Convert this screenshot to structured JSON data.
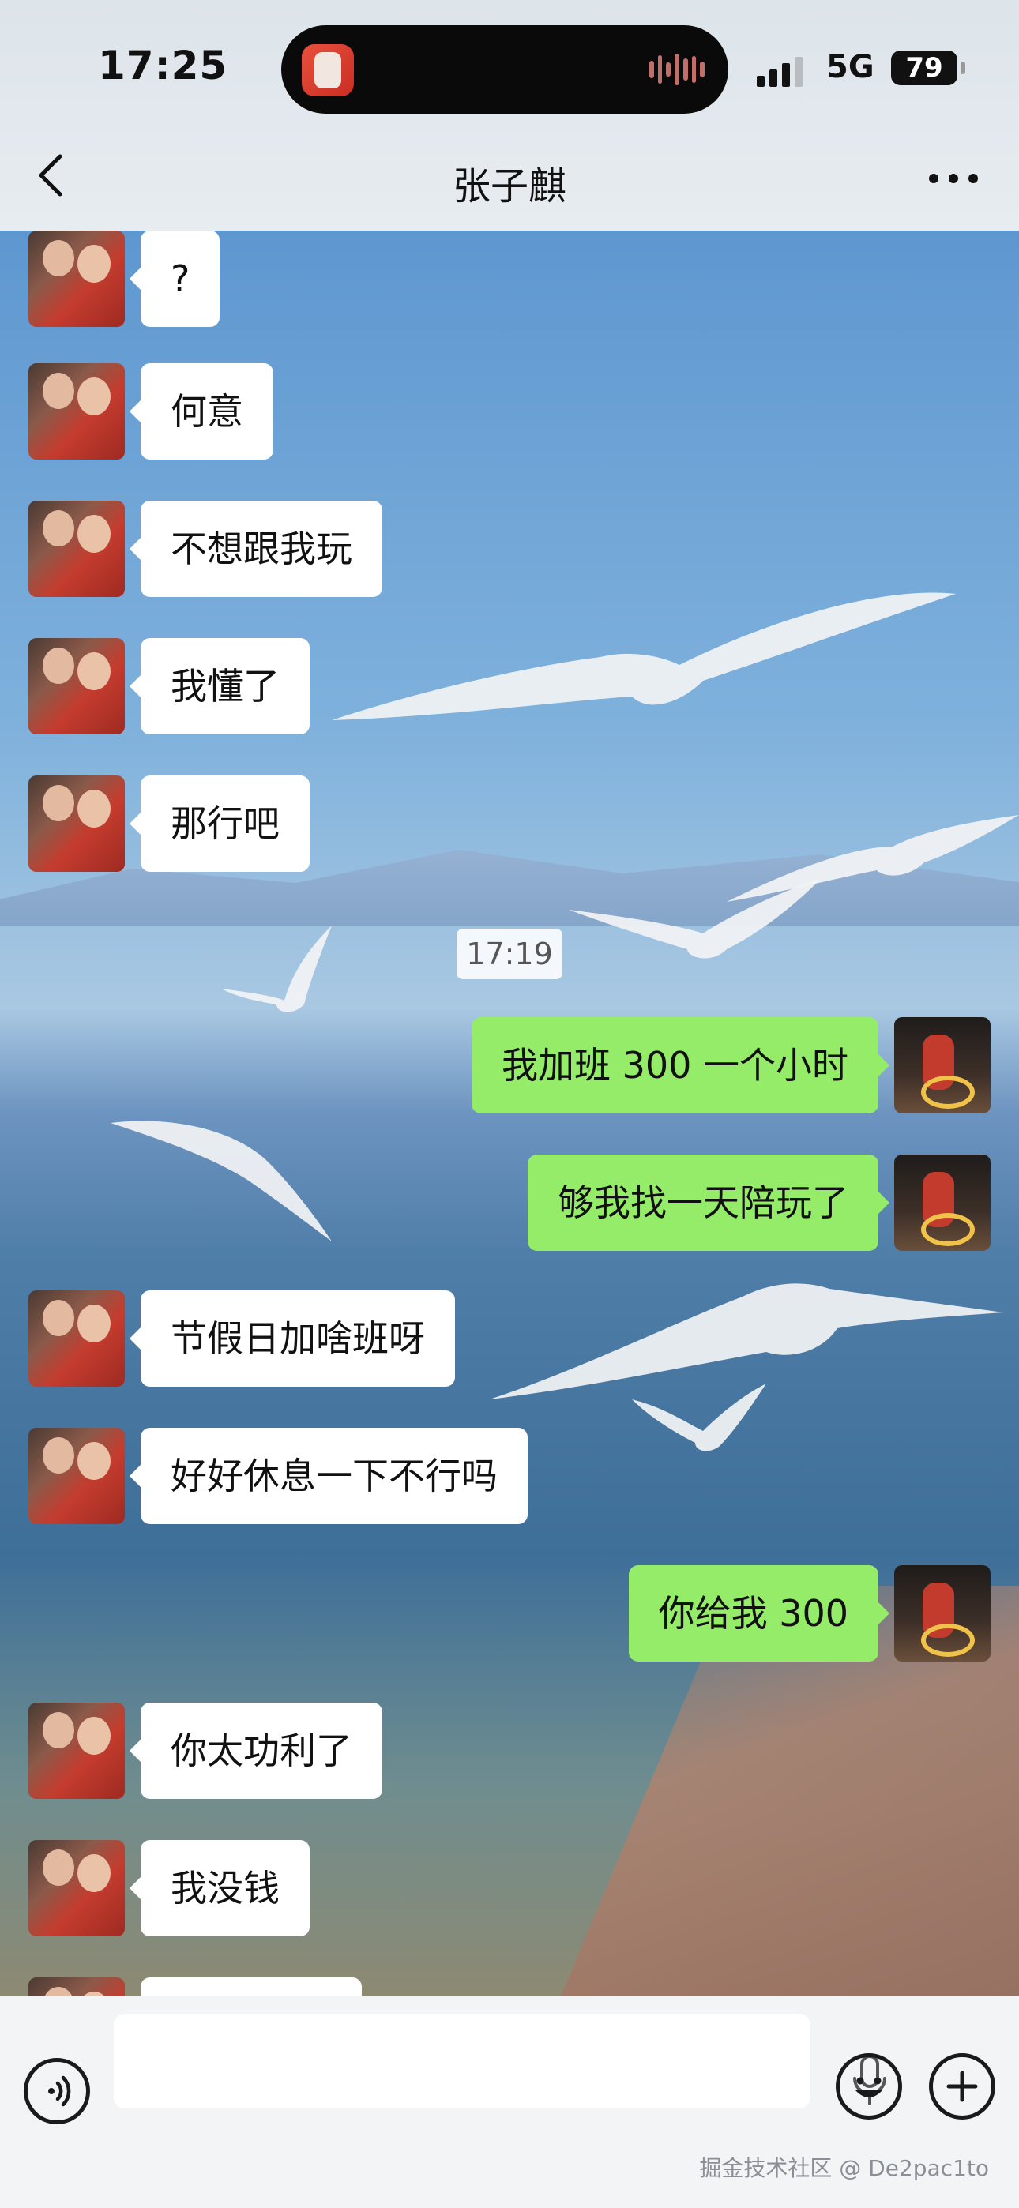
{
  "status_bar": {
    "time": "17:25",
    "network": "5G",
    "battery": "79"
  },
  "header": {
    "title": "张子麒"
  },
  "messages": [
    {
      "from": "them",
      "text": "?"
    },
    {
      "from": "them",
      "text": "何意"
    },
    {
      "from": "them",
      "text": "不想跟我玩"
    },
    {
      "from": "them",
      "text": "我懂了"
    },
    {
      "from": "them",
      "text": "那行吧"
    },
    {
      "from": "me",
      "text": "我加班 300 一个小时"
    },
    {
      "from": "me",
      "text": "够我找一天陪玩了"
    },
    {
      "from": "them",
      "text": "节假日加啥班呀"
    },
    {
      "from": "them",
      "text": "好好休息一下不行吗"
    },
    {
      "from": "me",
      "text": "你给我 300"
    },
    {
      "from": "them",
      "text": "你太功利了"
    },
    {
      "from": "them",
      "text": "我没钱"
    }
  ],
  "timestamp": "17:19",
  "input": {
    "placeholder": ""
  },
  "watermark": "掘金技术社区 @ De2pac1to",
  "colors": {
    "my_bubble": "#95ec69",
    "their_bubble": "#ffffff"
  },
  "icons": [
    "back-icon",
    "more-icon",
    "voice-icon",
    "mic-icon",
    "emoji-icon",
    "plus-icon"
  ]
}
